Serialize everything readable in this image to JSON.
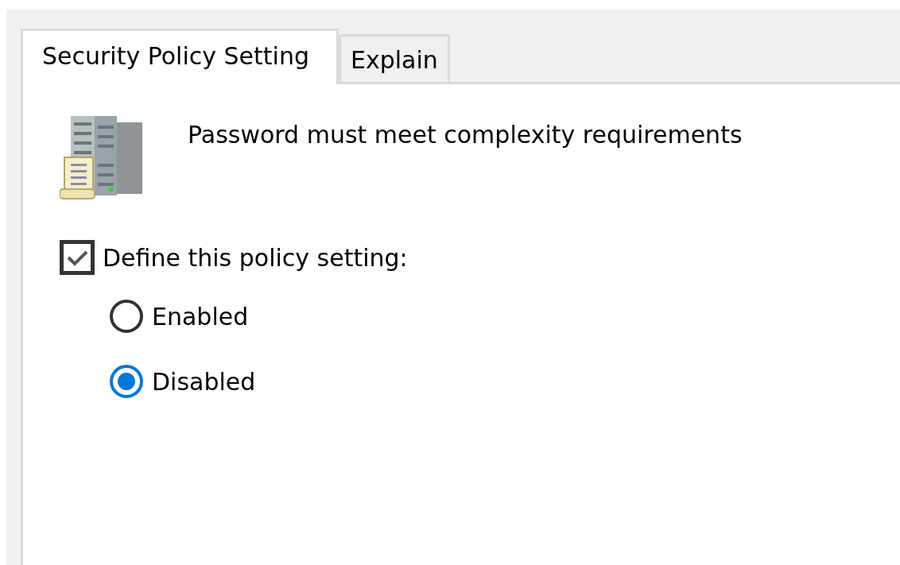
{
  "tabs": [
    {
      "label": "Security Policy Setting",
      "selected": true
    },
    {
      "label": "Explain",
      "selected": false
    }
  ],
  "policy": {
    "title": "Password must meet complexity requirements"
  },
  "define": {
    "label": "Define this policy setting:",
    "checked": true
  },
  "options": [
    {
      "label": "Enabled",
      "selected": false
    },
    {
      "label": "Disabled",
      "selected": true
    }
  ]
}
